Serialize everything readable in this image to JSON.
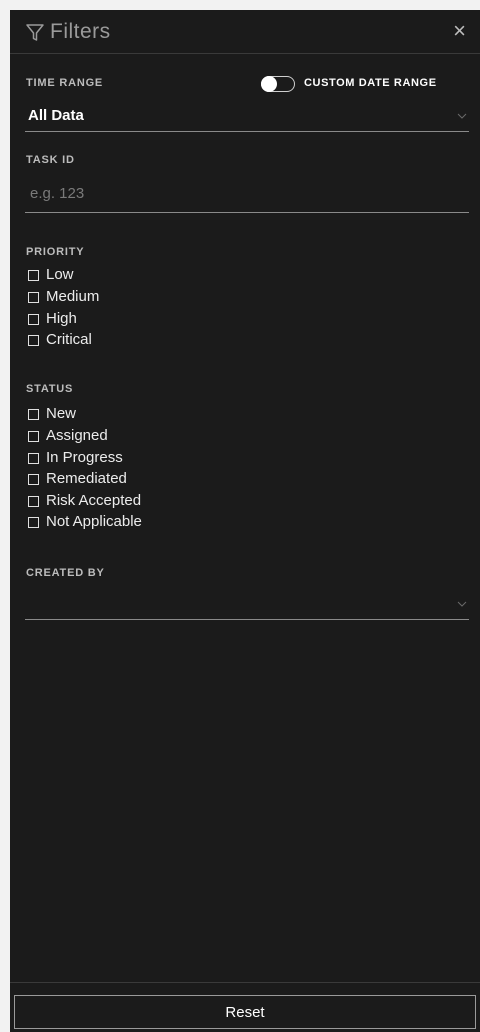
{
  "header": {
    "title": "Filters",
    "close": "×"
  },
  "time_range": {
    "label": "TIME RANGE",
    "custom_toggle_label": "CUSTOM DATE RANGE",
    "custom_toggle_on": false,
    "selected": "All Data"
  },
  "task_id": {
    "label": "TASK ID",
    "placeholder": "e.g. 123",
    "value": ""
  },
  "priority": {
    "label": "PRIORITY",
    "options": [
      {
        "label": "Low",
        "checked": false
      },
      {
        "label": "Medium",
        "checked": false
      },
      {
        "label": "High",
        "checked": false
      },
      {
        "label": "Critical",
        "checked": false
      }
    ]
  },
  "status": {
    "label": "STATUS",
    "options": [
      {
        "label": "New",
        "checked": false
      },
      {
        "label": "Assigned",
        "checked": false
      },
      {
        "label": "In Progress",
        "checked": false
      },
      {
        "label": "Remediated",
        "checked": false
      },
      {
        "label": "Risk Accepted",
        "checked": false
      },
      {
        "label": "Not Applicable",
        "checked": false
      }
    ]
  },
  "created_by": {
    "label": "CREATED BY",
    "selected": ""
  },
  "footer": {
    "reset_label": "Reset"
  },
  "colors": {
    "panel_bg": "#1b1b1b",
    "page_bg": "#f2f2f2",
    "text": "#ffffff",
    "muted": "#9a9a9a"
  }
}
